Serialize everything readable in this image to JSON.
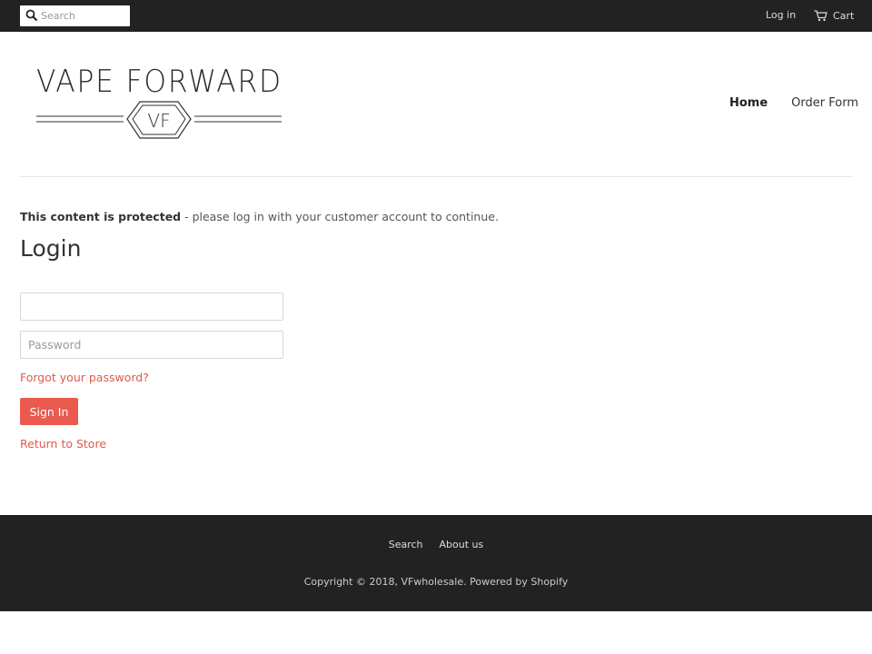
{
  "topbar": {
    "search_placeholder": "Search",
    "login_label": "Log in",
    "cart_label": "Cart",
    "icons": {
      "search": "search-icon",
      "cart": "cart-icon"
    }
  },
  "logo": {
    "text": "VAPE FORWARD",
    "emblem_text": "VF"
  },
  "nav": {
    "items": [
      {
        "label": "Home",
        "active": true
      },
      {
        "label": "Order Form",
        "active": false
      }
    ]
  },
  "notice": {
    "strong": "This content is protected",
    "rest": " - please log in with your customer account to continue."
  },
  "login": {
    "title": "Login",
    "email_value": "",
    "email_placeholder": "",
    "password_placeholder": "Password",
    "forgot_label": "Forgot your password?",
    "signin_label": "Sign In",
    "return_label": "Return to Store"
  },
  "footer": {
    "links": [
      "Search",
      "About us"
    ],
    "copyright": "Copyright © 2018, VFwholesale. Powered by Shopify"
  },
  "colors": {
    "topbar": "#222222",
    "accent": "#ea5a4f",
    "link": "#e05a4e",
    "footer": "#222222"
  }
}
